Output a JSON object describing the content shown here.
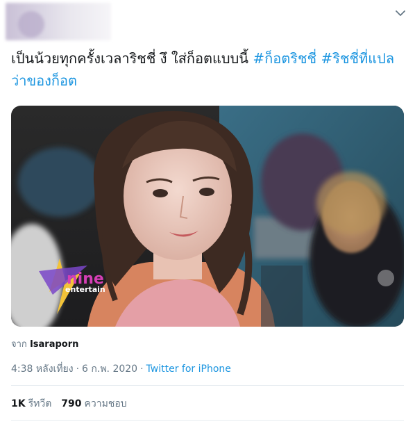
{
  "tweet": {
    "text_plain": "เป็นน้วยทุกครั้งเวลาริชชี่ งึ ใส่ก็อตแบบนี้ ",
    "hashtag_1": "#ก็อตริชชี่",
    "hashtag_2": "#ริชชี่ที่แปลว่าของก็อต",
    "media_watermark_line1": "nine",
    "media_watermark_line2": "entertain",
    "from_prefix": "จาก",
    "from_name": "Isaraporn",
    "time": "4:38 หลังเที่ยง",
    "date": "6 ก.พ. 2020",
    "source": "Twitter for iPhone",
    "separator": "·",
    "retweets_count": "1K",
    "retweets_label": "รีทวีต",
    "likes_count": "790",
    "likes_label": "ความชอบ"
  },
  "icons": {
    "menu": "chevron-down-icon"
  },
  "colors": {
    "accent": "#1b95e0",
    "text": "#14171a",
    "muted": "#657786",
    "divider": "#e6ecf0"
  }
}
